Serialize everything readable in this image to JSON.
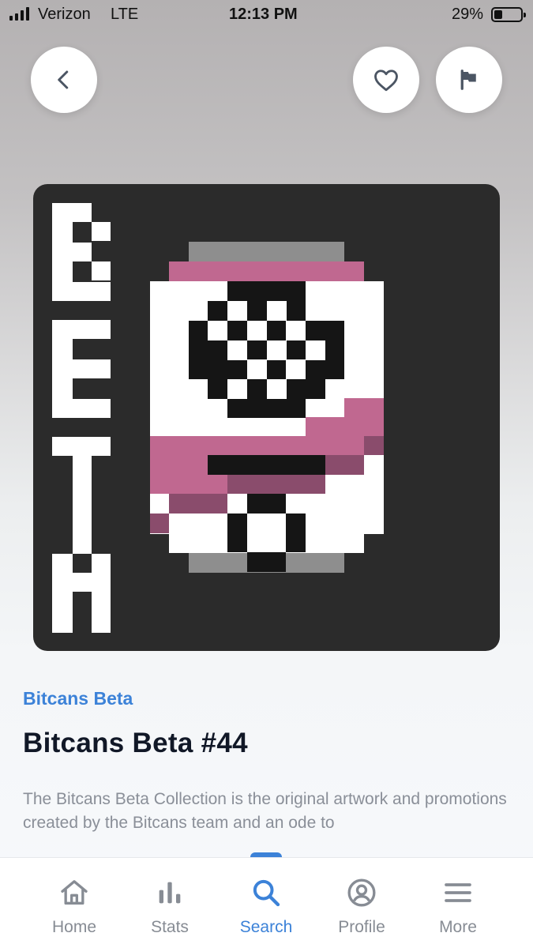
{
  "status_bar": {
    "carrier": "Verizon",
    "network": "LTE",
    "time": "12:13 PM",
    "battery": "29%"
  },
  "header": {
    "back_icon": "chevron-left-icon",
    "favorite_icon": "heart-icon",
    "report_icon": "flag-icon"
  },
  "artwork": {
    "vertical_text": "BETA",
    "background_color": "#2b2b2b",
    "accent_color": "#c06890"
  },
  "details": {
    "collection": "Bitcans Beta",
    "title": "Bitcans Beta #44",
    "description": "The Bitcans Beta Collection is the original artwork and promotions created by the Bitcans team and an ode to"
  },
  "tab_bar": {
    "active": "Search",
    "accent_color": "#3c82d8",
    "tabs": [
      {
        "label": "Home",
        "icon": "home-icon"
      },
      {
        "label": "Stats",
        "icon": "bar-chart-icon"
      },
      {
        "label": "Search",
        "icon": "search-icon"
      },
      {
        "label": "Profile",
        "icon": "user-circle-icon"
      },
      {
        "label": "More",
        "icon": "menu-icon"
      }
    ]
  }
}
